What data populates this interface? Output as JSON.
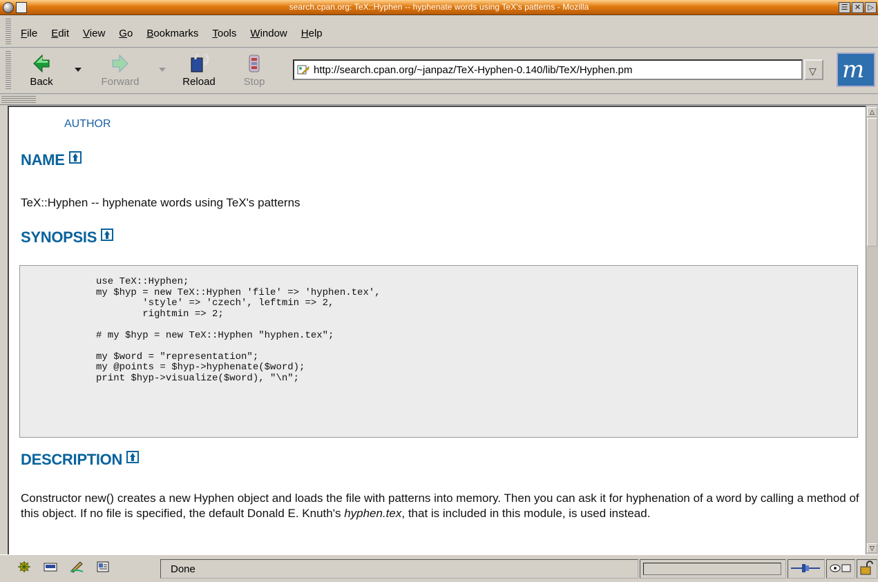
{
  "window": {
    "title": "search.cpan.org: TeX::Hyphen -- hyphenate words using TeX's patterns - Mozilla"
  },
  "menubar": {
    "items": [
      {
        "label": "File",
        "key": "F",
        "rest": "ile"
      },
      {
        "label": "Edit",
        "key": "E",
        "rest": "dit"
      },
      {
        "label": "View",
        "key": "V",
        "rest": "iew"
      },
      {
        "label": "Go",
        "key": "G",
        "rest": "o"
      },
      {
        "label": "Bookmarks",
        "key": "B",
        "rest": "ookmarks"
      },
      {
        "label": "Tools",
        "key": "T",
        "rest": "ools"
      },
      {
        "label": "Window",
        "key": "W",
        "rest": "indow"
      },
      {
        "label": "Help",
        "key": "H",
        "rest": "elp"
      }
    ]
  },
  "navbar": {
    "back_label": "Back",
    "forward_label": "Forward",
    "reload_label": "Reload",
    "stop_label": "Stop",
    "url": "http://search.cpan.org/~janpaz/TeX-Hyphen-0.140/lib/TeX/Hyphen.pm",
    "logo_letter": "m"
  },
  "page": {
    "toc_author": "AUTHOR",
    "name_heading": "NAME",
    "name_text": "TeX::Hyphen -- hyphenate words using TeX's patterns",
    "synopsis_heading": "SYNOPSIS",
    "synopsis_code": "use TeX::Hyphen;\nmy $hyp = new TeX::Hyphen 'file' => 'hyphen.tex',\n        'style' => 'czech', leftmin => 2,\n        rightmin => 2;\n\n# my $hyp = new TeX::Hyphen \"hyphen.tex\";\n\nmy $word = \"representation\";\nmy @points = $hyp->hyphenate($word);\nprint $hyp->visualize($word), \"\\n\";",
    "description_heading": "DESCRIPTION",
    "description_text_1": "Constructor new() creates a new Hyphen object and loads the file with patterns into memory. Then you can ask it for hyphenation of a word by calling a method of this object. If no file is specified, the default Donald E. Knuth's ",
    "description_em": "hyphen.tex",
    "description_text_2": ", that is included in this module, is used instead."
  },
  "statusbar": {
    "status_text": "Done",
    "icons": [
      "navigator-icon",
      "mail-icon",
      "composer-icon",
      "addressbook-icon"
    ]
  }
}
